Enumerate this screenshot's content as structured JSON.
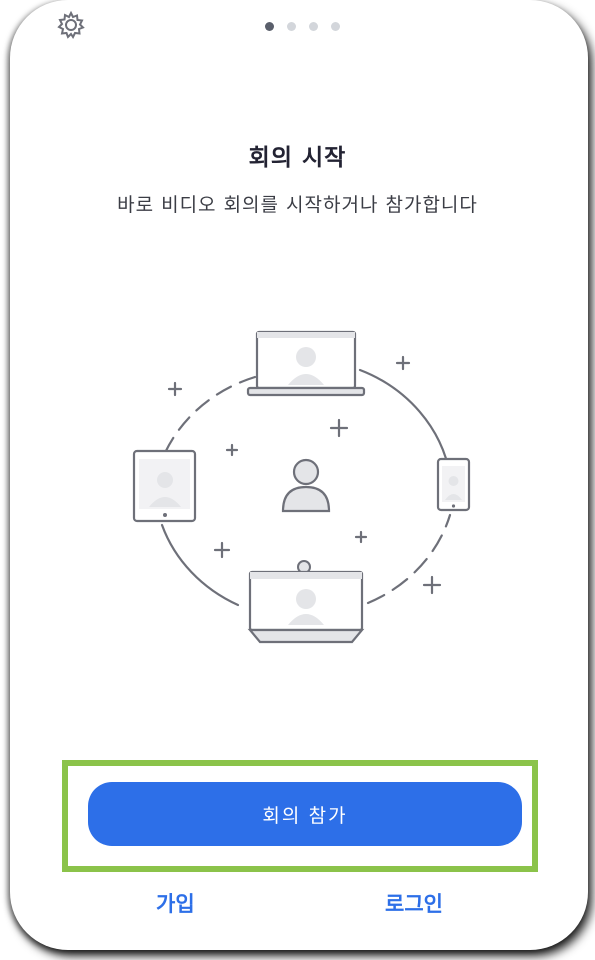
{
  "pagination": {
    "active_index": 0,
    "count": 4
  },
  "onboarding": {
    "title": "회의 시작",
    "subtitle": "바로 비디오 회의를 시작하거나 참가합니다"
  },
  "actions": {
    "join_meeting_label": "회의 참가",
    "signup_label": "가입",
    "login_label": "로그인"
  },
  "colors": {
    "accent": "#2d6fe8",
    "highlight_border": "#8bc34a",
    "text_primary": "#232333",
    "illustration_stroke": "#6e7079",
    "illustration_fill": "#e4e5e8"
  },
  "icons": {
    "settings": "gear-icon",
    "illustration": "video-devices-circle-illustration"
  }
}
